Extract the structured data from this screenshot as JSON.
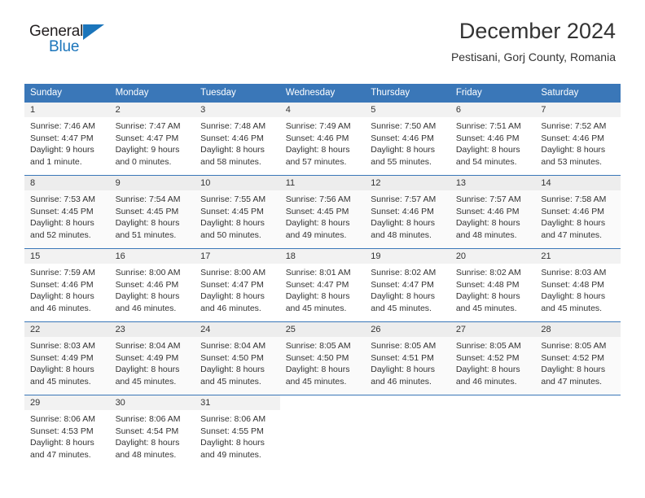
{
  "brand": {
    "name_top": "General",
    "name_bottom": "Blue",
    "accent_color": "#1b75bb"
  },
  "header": {
    "title": "December 2024",
    "subtitle": "Pestisani, Gorj County, Romania"
  },
  "theme": {
    "header_blue": "#3a77b8",
    "row_stripe": "#f2f2f2",
    "text": "#333333"
  },
  "weekday_headers": [
    "Sunday",
    "Monday",
    "Tuesday",
    "Wednesday",
    "Thursday",
    "Friday",
    "Saturday"
  ],
  "labels": {
    "sunrise_prefix": "Sunrise:",
    "sunset_prefix": "Sunset:",
    "daylight_prefix": "Daylight:"
  },
  "weeks": [
    [
      {
        "day": "1",
        "sunrise": "Sunrise: 7:46 AM",
        "sunset": "Sunset: 4:47 PM",
        "daylight1": "Daylight: 9 hours",
        "daylight2": "and 1 minute."
      },
      {
        "day": "2",
        "sunrise": "Sunrise: 7:47 AM",
        "sunset": "Sunset: 4:47 PM",
        "daylight1": "Daylight: 9 hours",
        "daylight2": "and 0 minutes."
      },
      {
        "day": "3",
        "sunrise": "Sunrise: 7:48 AM",
        "sunset": "Sunset: 4:46 PM",
        "daylight1": "Daylight: 8 hours",
        "daylight2": "and 58 minutes."
      },
      {
        "day": "4",
        "sunrise": "Sunrise: 7:49 AM",
        "sunset": "Sunset: 4:46 PM",
        "daylight1": "Daylight: 8 hours",
        "daylight2": "and 57 minutes."
      },
      {
        "day": "5",
        "sunrise": "Sunrise: 7:50 AM",
        "sunset": "Sunset: 4:46 PM",
        "daylight1": "Daylight: 8 hours",
        "daylight2": "and 55 minutes."
      },
      {
        "day": "6",
        "sunrise": "Sunrise: 7:51 AM",
        "sunset": "Sunset: 4:46 PM",
        "daylight1": "Daylight: 8 hours",
        "daylight2": "and 54 minutes."
      },
      {
        "day": "7",
        "sunrise": "Sunrise: 7:52 AM",
        "sunset": "Sunset: 4:46 PM",
        "daylight1": "Daylight: 8 hours",
        "daylight2": "and 53 minutes."
      }
    ],
    [
      {
        "day": "8",
        "sunrise": "Sunrise: 7:53 AM",
        "sunset": "Sunset: 4:45 PM",
        "daylight1": "Daylight: 8 hours",
        "daylight2": "and 52 minutes."
      },
      {
        "day": "9",
        "sunrise": "Sunrise: 7:54 AM",
        "sunset": "Sunset: 4:45 PM",
        "daylight1": "Daylight: 8 hours",
        "daylight2": "and 51 minutes."
      },
      {
        "day": "10",
        "sunrise": "Sunrise: 7:55 AM",
        "sunset": "Sunset: 4:45 PM",
        "daylight1": "Daylight: 8 hours",
        "daylight2": "and 50 minutes."
      },
      {
        "day": "11",
        "sunrise": "Sunrise: 7:56 AM",
        "sunset": "Sunset: 4:45 PM",
        "daylight1": "Daylight: 8 hours",
        "daylight2": "and 49 minutes."
      },
      {
        "day": "12",
        "sunrise": "Sunrise: 7:57 AM",
        "sunset": "Sunset: 4:46 PM",
        "daylight1": "Daylight: 8 hours",
        "daylight2": "and 48 minutes."
      },
      {
        "day": "13",
        "sunrise": "Sunrise: 7:57 AM",
        "sunset": "Sunset: 4:46 PM",
        "daylight1": "Daylight: 8 hours",
        "daylight2": "and 48 minutes."
      },
      {
        "day": "14",
        "sunrise": "Sunrise: 7:58 AM",
        "sunset": "Sunset: 4:46 PM",
        "daylight1": "Daylight: 8 hours",
        "daylight2": "and 47 minutes."
      }
    ],
    [
      {
        "day": "15",
        "sunrise": "Sunrise: 7:59 AM",
        "sunset": "Sunset: 4:46 PM",
        "daylight1": "Daylight: 8 hours",
        "daylight2": "and 46 minutes."
      },
      {
        "day": "16",
        "sunrise": "Sunrise: 8:00 AM",
        "sunset": "Sunset: 4:46 PM",
        "daylight1": "Daylight: 8 hours",
        "daylight2": "and 46 minutes."
      },
      {
        "day": "17",
        "sunrise": "Sunrise: 8:00 AM",
        "sunset": "Sunset: 4:47 PM",
        "daylight1": "Daylight: 8 hours",
        "daylight2": "and 46 minutes."
      },
      {
        "day": "18",
        "sunrise": "Sunrise: 8:01 AM",
        "sunset": "Sunset: 4:47 PM",
        "daylight1": "Daylight: 8 hours",
        "daylight2": "and 45 minutes."
      },
      {
        "day": "19",
        "sunrise": "Sunrise: 8:02 AM",
        "sunset": "Sunset: 4:47 PM",
        "daylight1": "Daylight: 8 hours",
        "daylight2": "and 45 minutes."
      },
      {
        "day": "20",
        "sunrise": "Sunrise: 8:02 AM",
        "sunset": "Sunset: 4:48 PM",
        "daylight1": "Daylight: 8 hours",
        "daylight2": "and 45 minutes."
      },
      {
        "day": "21",
        "sunrise": "Sunrise: 8:03 AM",
        "sunset": "Sunset: 4:48 PM",
        "daylight1": "Daylight: 8 hours",
        "daylight2": "and 45 minutes."
      }
    ],
    [
      {
        "day": "22",
        "sunrise": "Sunrise: 8:03 AM",
        "sunset": "Sunset: 4:49 PM",
        "daylight1": "Daylight: 8 hours",
        "daylight2": "and 45 minutes."
      },
      {
        "day": "23",
        "sunrise": "Sunrise: 8:04 AM",
        "sunset": "Sunset: 4:49 PM",
        "daylight1": "Daylight: 8 hours",
        "daylight2": "and 45 minutes."
      },
      {
        "day": "24",
        "sunrise": "Sunrise: 8:04 AM",
        "sunset": "Sunset: 4:50 PM",
        "daylight1": "Daylight: 8 hours",
        "daylight2": "and 45 minutes."
      },
      {
        "day": "25",
        "sunrise": "Sunrise: 8:05 AM",
        "sunset": "Sunset: 4:50 PM",
        "daylight1": "Daylight: 8 hours",
        "daylight2": "and 45 minutes."
      },
      {
        "day": "26",
        "sunrise": "Sunrise: 8:05 AM",
        "sunset": "Sunset: 4:51 PM",
        "daylight1": "Daylight: 8 hours",
        "daylight2": "and 46 minutes."
      },
      {
        "day": "27",
        "sunrise": "Sunrise: 8:05 AM",
        "sunset": "Sunset: 4:52 PM",
        "daylight1": "Daylight: 8 hours",
        "daylight2": "and 46 minutes."
      },
      {
        "day": "28",
        "sunrise": "Sunrise: 8:05 AM",
        "sunset": "Sunset: 4:52 PM",
        "daylight1": "Daylight: 8 hours",
        "daylight2": "and 47 minutes."
      }
    ],
    [
      {
        "day": "29",
        "sunrise": "Sunrise: 8:06 AM",
        "sunset": "Sunset: 4:53 PM",
        "daylight1": "Daylight: 8 hours",
        "daylight2": "and 47 minutes."
      },
      {
        "day": "30",
        "sunrise": "Sunrise: 8:06 AM",
        "sunset": "Sunset: 4:54 PM",
        "daylight1": "Daylight: 8 hours",
        "daylight2": "and 48 minutes."
      },
      {
        "day": "31",
        "sunrise": "Sunrise: 8:06 AM",
        "sunset": "Sunset: 4:55 PM",
        "daylight1": "Daylight: 8 hours",
        "daylight2": "and 49 minutes."
      },
      {
        "day": "",
        "sunrise": "",
        "sunset": "",
        "daylight1": "",
        "daylight2": ""
      },
      {
        "day": "",
        "sunrise": "",
        "sunset": "",
        "daylight1": "",
        "daylight2": ""
      },
      {
        "day": "",
        "sunrise": "",
        "sunset": "",
        "daylight1": "",
        "daylight2": ""
      },
      {
        "day": "",
        "sunrise": "",
        "sunset": "",
        "daylight1": "",
        "daylight2": ""
      }
    ]
  ]
}
